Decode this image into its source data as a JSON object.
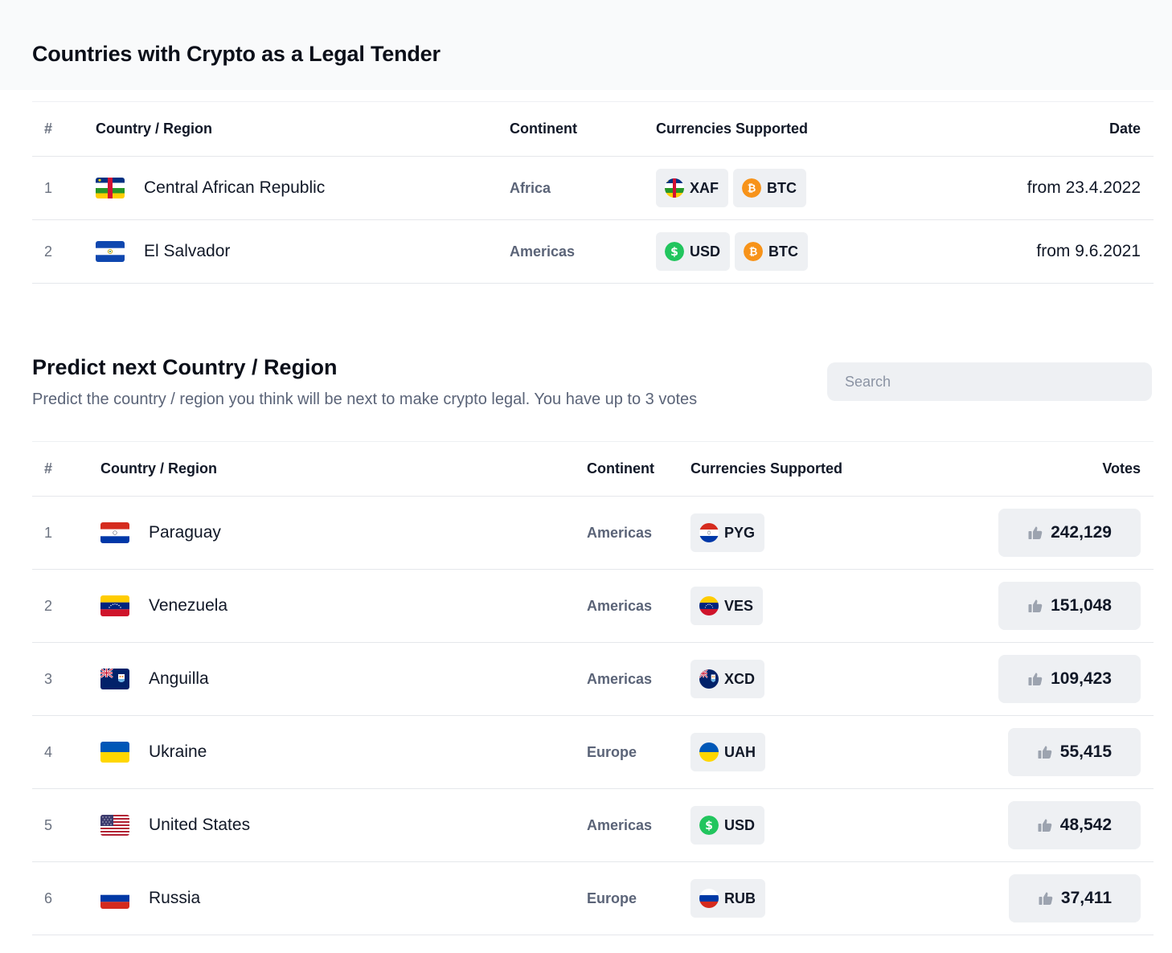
{
  "legal": {
    "title": "Countries with Crypto as a Legal Tender",
    "headers": {
      "num": "#",
      "country": "Country / Region",
      "continent": "Continent",
      "currencies": "Currencies Supported",
      "date": "Date"
    },
    "rows": [
      {
        "rank": "1",
        "country": "Central African Republic",
        "flag": "central-african-republic-flag",
        "continent": "Africa",
        "currencies": [
          {
            "code": "XAF",
            "icon": "central-african-republic-flag"
          },
          {
            "code": "BTC",
            "icon": "bitcoin-icon"
          }
        ],
        "date": "from 23.4.2022"
      },
      {
        "rank": "2",
        "country": "El Salvador",
        "flag": "el-salvador-flag",
        "continent": "Americas",
        "currencies": [
          {
            "code": "USD",
            "icon": "dollar-icon"
          },
          {
            "code": "BTC",
            "icon": "bitcoin-icon"
          }
        ],
        "date": "from 9.6.2021"
      }
    ]
  },
  "predict": {
    "title": "Predict next Country / Region",
    "subtitle": "Predict the country / region you think will be next to make crypto legal. You have up to 3 votes",
    "search_placeholder": "Search",
    "headers": {
      "num": "#",
      "country": "Country / Region",
      "continent": "Continent",
      "currencies": "Currencies Supported",
      "votes": "Votes"
    },
    "rows": [
      {
        "rank": "1",
        "country": "Paraguay",
        "flag": "paraguay-flag",
        "continent": "Americas",
        "currencies": [
          {
            "code": "PYG",
            "icon": "paraguay-flag"
          }
        ],
        "votes": "242,129"
      },
      {
        "rank": "2",
        "country": "Venezuela",
        "flag": "venezuela-flag",
        "continent": "Americas",
        "currencies": [
          {
            "code": "VES",
            "icon": "venezuela-flag"
          }
        ],
        "votes": "151,048"
      },
      {
        "rank": "3",
        "country": "Anguilla",
        "flag": "anguilla-flag",
        "continent": "Americas",
        "currencies": [
          {
            "code": "XCD",
            "icon": "anguilla-flag"
          }
        ],
        "votes": "109,423"
      },
      {
        "rank": "4",
        "country": "Ukraine",
        "flag": "ukraine-flag",
        "continent": "Europe",
        "currencies": [
          {
            "code": "UAH",
            "icon": "ukraine-flag"
          }
        ],
        "votes": "55,415"
      },
      {
        "rank": "5",
        "country": "United States",
        "flag": "united-states-flag",
        "continent": "Americas",
        "currencies": [
          {
            "code": "USD",
            "icon": "dollar-icon"
          }
        ],
        "votes": "48,542"
      },
      {
        "rank": "6",
        "country": "Russia",
        "flag": "russia-flag",
        "continent": "Europe",
        "currencies": [
          {
            "code": "RUB",
            "icon": "russia-flag"
          }
        ],
        "votes": "37,411"
      }
    ]
  },
  "colors": {
    "chip_bg": "#eef0f3",
    "muted_text": "#5b6478",
    "bitcoin": "#f7931a",
    "dollar": "#22c55e"
  }
}
